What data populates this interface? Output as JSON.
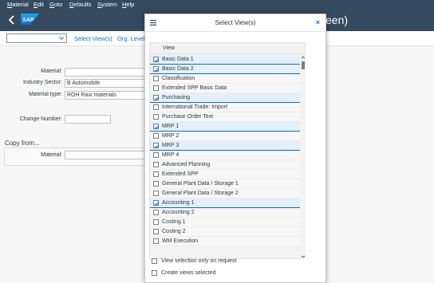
{
  "menu": [
    "Material",
    "Edit",
    "Goto",
    "Defaults",
    "System",
    "Help"
  ],
  "shell": {
    "logo_text": "SAP",
    "title_fragment": "een)"
  },
  "toolbar": {
    "dropdown_value": "",
    "select_views_label": "Select View(s)",
    "org_levels_label": "Org. Levels"
  },
  "form": {
    "material_label": "Material:",
    "material_value": "",
    "industry_sector_label": "Industry Sector:",
    "industry_sector_value": "B Automobile",
    "material_type_label": "Material type:",
    "material_type_value": "ROH Raw materials",
    "change_number_label": "Change Number:",
    "change_number_value": "",
    "copy_from_label": "Copy from...",
    "copy_material_label": "Material:",
    "copy_material_value": ""
  },
  "dialog": {
    "title": "Select View(s)",
    "close_label": "×",
    "column_header": "View",
    "views": [
      {
        "label": "Basic Data 1",
        "checked": true
      },
      {
        "label": "Basic Data 2",
        "checked": true
      },
      {
        "label": "Classification",
        "checked": false
      },
      {
        "label": "Extended SPP Basic Data",
        "checked": false
      },
      {
        "label": "Purchasing",
        "checked": true
      },
      {
        "label": "International Trade: Import",
        "checked": false
      },
      {
        "label": "Purchase Order Text",
        "checked": false
      },
      {
        "label": "MRP 1",
        "checked": true
      },
      {
        "label": "MRP 2",
        "checked": false
      },
      {
        "label": "MRP 3",
        "checked": true
      },
      {
        "label": "MRP 4",
        "checked": false
      },
      {
        "label": "Advanced Planning",
        "checked": false
      },
      {
        "label": "Extended SPP",
        "checked": false
      },
      {
        "label": "General Plant Data / Storage 1",
        "checked": false
      },
      {
        "label": "General Plant Data / Storage 2",
        "checked": false
      },
      {
        "label": "Accounting 1",
        "checked": true
      },
      {
        "label": "Accounting 2",
        "checked": false
      },
      {
        "label": "Costing 1",
        "checked": false
      },
      {
        "label": "Costing 2",
        "checked": false
      },
      {
        "label": "WM Execution",
        "checked": false
      }
    ],
    "option_view_selection": "View selection only on request",
    "option_create_views": "Create views selected",
    "option_view_selection_checked": false,
    "option_create_views_checked": false
  },
  "colors": {
    "shell_bg": "#354a5f",
    "link": "#0a6ed1",
    "selected_row": "#e5f0fa"
  }
}
